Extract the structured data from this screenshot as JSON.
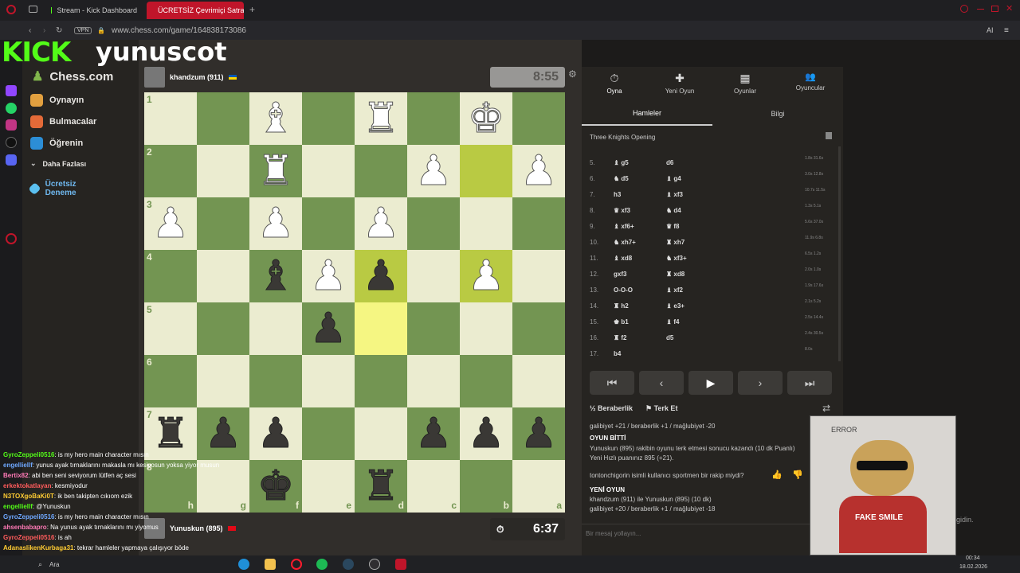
{
  "browser": {
    "tabs": [
      {
        "label": "Stream - Kick Dashboard"
      },
      {
        "label": "ÜCRETSİZ Çevrimiçi Satra"
      }
    ],
    "url": "www.chess.com/game/164838173086",
    "vpn": "VPN",
    "ai": "AI"
  },
  "stream": {
    "logo": "KICK",
    "username": "yunuscot"
  },
  "chessnav": {
    "brand": "Chess.com",
    "items": [
      {
        "label": "Oynayın"
      },
      {
        "label": "Bulmacalar"
      },
      {
        "label": "Öğrenin"
      },
      {
        "label": "Daha Fazlası"
      },
      {
        "label": "Ücretsiz Deneme"
      }
    ]
  },
  "top_player": {
    "name": "khandzum (911)",
    "clock": "8:55"
  },
  "bottom_player": {
    "name": "Yunuskun (895)",
    "clock": "6:37"
  },
  "board": {
    "ranks": [
      "1",
      "2",
      "3",
      "4",
      "5",
      "6",
      "7",
      "8"
    ],
    "files": [
      "h",
      "g",
      "f",
      "e",
      "d",
      "c",
      "b",
      "a"
    ],
    "rows": [
      [
        "",
        "",
        "♝w",
        "",
        "♜w",
        "",
        "♚w",
        ""
      ],
      [
        "",
        "",
        "♜w",
        "",
        "",
        "♟w",
        "",
        "♟w"
      ],
      [
        "♟w",
        "",
        "♟w",
        "",
        "♟w",
        "",
        "",
        ""
      ],
      [
        "",
        "",
        "♝b",
        "♟w",
        "♟b",
        "",
        "♟w",
        ""
      ],
      [
        "",
        "",
        "",
        "♟b",
        "",
        "",
        "",
        ""
      ],
      [
        "",
        "",
        "",
        "",
        "",
        "",
        "",
        ""
      ],
      [
        "♜b",
        "♟b",
        "♟b",
        "",
        "",
        "♟b",
        "♟b",
        "♟b"
      ],
      [
        "",
        "",
        "♚b",
        "",
        "♜b",
        "",
        "",
        ""
      ]
    ],
    "highlights": [
      [
        1,
        6
      ],
      [
        3,
        6
      ],
      [
        4,
        4
      ],
      [
        3,
        4
      ]
    ]
  },
  "panel": {
    "tabs": [
      {
        "label": "Oyna",
        "icon": "⏱"
      },
      {
        "label": "Yeni Oyun",
        "icon": "✚"
      },
      {
        "label": "Oyunlar",
        "icon": "▦"
      },
      {
        "label": "Oyuncular",
        "icon": "👥"
      }
    ],
    "subtabs": [
      "Hamleler",
      "Bilgi"
    ],
    "opening": "Three Knights Opening",
    "moves": [
      {
        "n": "5.",
        "w": "♝ g5",
        "b": "d6",
        "t": "1.8s 31.6s"
      },
      {
        "n": "6.",
        "w": "♞ d5",
        "b": "♝ g4",
        "t": "3.0s 12.8s"
      },
      {
        "n": "7.",
        "w": "h3",
        "b": "♝ xf3",
        "t": "10.7s 11.5s"
      },
      {
        "n": "8.",
        "w": "♛ xf3",
        "b": "♞ d4",
        "t": "1.3s 5.1s"
      },
      {
        "n": "9.",
        "w": "♝ xf6+",
        "b": "♛ f8",
        "t": "5.6s 37.0s"
      },
      {
        "n": "10.",
        "w": "♞ xh7+",
        "b": "♜ xh7",
        "t": "11.9s 6.8s"
      },
      {
        "n": "11.",
        "w": "♝ xd8",
        "b": "♞ xf3+",
        "t": "6.5s 1.2s"
      },
      {
        "n": "12.",
        "w": "gxf3",
        "b": "♜ xd8",
        "t": "2.0s 1.0s"
      },
      {
        "n": "13.",
        "w": "O-O-O",
        "b": "♝ xf2",
        "t": "1.9s 17.6s"
      },
      {
        "n": "14.",
        "w": "♜ h2",
        "b": "♝ e3+",
        "t": "2.1s 5.2s"
      },
      {
        "n": "15.",
        "w": "♚ b1",
        "b": "♝ f4",
        "t": "2.5s 14.4s"
      },
      {
        "n": "16.",
        "w": "♜ f2",
        "b": "d5",
        "t": "2.4s 30.5s"
      },
      {
        "n": "17.",
        "w": "b4",
        "b": "",
        "t": "8.0s"
      }
    ],
    "draw": "Beraberlik",
    "resign": "Terk Et",
    "chat": [
      "galibiyet +21 / beraberlik +1 / mağlubiyet -20",
      "OYUN BİTTİ",
      "Yunuskun (895) rakibin oyunu terk etmesi sonucu kazandı (10 dk Puanlı)",
      "Yeni Hızlı puanınız 895 (+21).",
      "tontonchigorin isimli kullanıcı sportmen bir rakip miydi?",
      "YENİ OYUN",
      "khandzum (911) ile Yunuskun (895) (10 dk)",
      "galibiyet +20 / beraberlik +1 / mağlubiyet -18"
    ],
    "chat_placeholder": "Bir mesaj yollayın..."
  },
  "streamchat": [
    {
      "u": "GyroZeppeli0516",
      "m": ": is my hero main character mısın"
    },
    {
      "u": "engelliellf",
      "m": ": yunus ayak tırnaklarını makasla mı kesiyosun yoksa yiyor musun"
    },
    {
      "u": "Bertix82",
      "m": ": abi ben seni seviyorum lütfen aç sesi"
    },
    {
      "u": "erkektokatlayan",
      "m": ": kesmiyodur"
    },
    {
      "u": "N3TOXgoBaKi0T",
      "m": ": ik ben takipten cıkıom ezik"
    },
    {
      "u": "engelliellf",
      "m": ": @Yunuskun"
    },
    {
      "u": "GyroZeppeli0516",
      "m": ": is my hero main character mısın"
    },
    {
      "u": "ahsenbabapro",
      "m": ": Na yunus ayak tırnaklarını mı yiyomus"
    },
    {
      "u": "GyroZeppeli0516",
      "m": ": is ah"
    },
    {
      "u": "AdanaslikenKurbaga31",
      "m": ": tekrar hamleler yapmaya çalışıyor böde"
    }
  ],
  "overlay": {
    "bear_caption": "FAKE SMILE",
    "error": "ERROR",
    "side_text": "gidin."
  },
  "taskbar": {
    "search": "Ara",
    "time": "00:34",
    "date": "18.02.2026"
  }
}
